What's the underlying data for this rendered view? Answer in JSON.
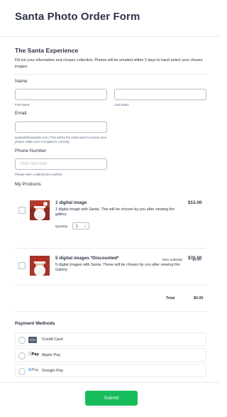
{
  "page_title": "Santa Photo Order Form",
  "section": {
    "title": "The Santa Experience",
    "description": "Fill out your information and chosen collection. Photos will be emailed within 2 days to hand select your chosen images."
  },
  "name_field": {
    "label": "Name",
    "first_sublabel": "First Name",
    "last_sublabel": "Last Name",
    "first_value": "",
    "last_value": ""
  },
  "email_field": {
    "label": "Email",
    "value": "",
    "sublabel": "example@example.com | This will be the email used to receive your photos. Make sure it is typed in correctly."
  },
  "phone_field": {
    "label": "Phone Number",
    "placeholder": "(000) 000-0000",
    "sublabel": "Please enter a valid phone number."
  },
  "products": {
    "label": "My Products",
    "items": [
      {
        "name": "1 digital image",
        "price": "$15.00",
        "description": "1 digital image with Santa. This will be chosen by you after viewing the gallery",
        "quantity_label": "Quantity",
        "quantity_value": "1",
        "subtotal_label": "Item subtotal:",
        "subtotal_value": "$0.00",
        "checked": false
      },
      {
        "name": "5 digital images *Discounted*",
        "price": "$70.00",
        "description": "5 digital images with Santa. These will be chosen by you after viewing the Gallery",
        "checked": false
      }
    ],
    "total_label": "Total",
    "total_value": "$0.00"
  },
  "payment": {
    "title": "Payment Methods",
    "options": [
      {
        "label": "Credit Card",
        "icon": "credit-card-icon"
      },
      {
        "label": "Apple Pay",
        "icon": "apple-pay-icon",
        "icon_text": "Pay"
      },
      {
        "label": "Google Pay",
        "icon": "google-pay-icon",
        "icon_text": "Pay"
      }
    ]
  },
  "submit_label": "Submit",
  "colors": {
    "text": "#2c3345",
    "border": "#b8bdc9",
    "submit": "#18bd5b"
  }
}
